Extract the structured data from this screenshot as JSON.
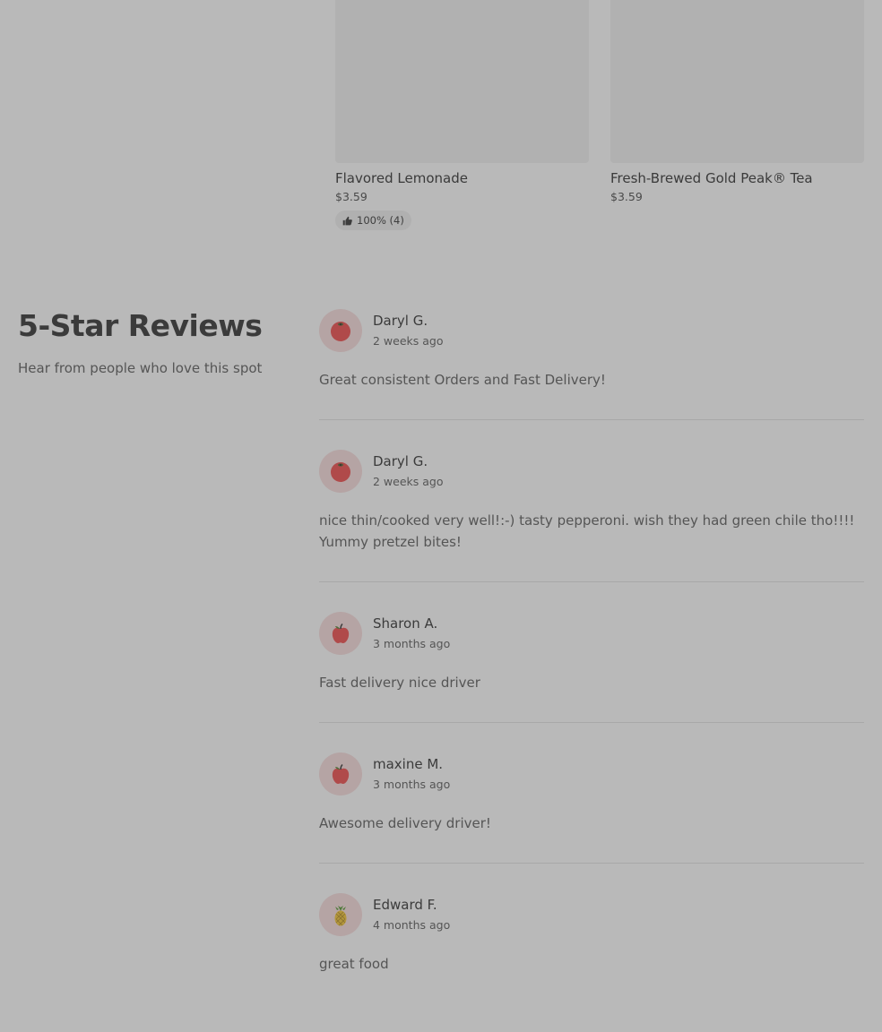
{
  "products": [
    {
      "name": "Flavored Lemonade",
      "price": "$3.59",
      "rating": "100% (4)",
      "has_rating": true
    },
    {
      "name": "Fresh-Brewed Gold Peak® Tea",
      "price": "$3.59",
      "rating": "",
      "has_rating": false
    }
  ],
  "reviews_section": {
    "title": "5-Star Reviews",
    "subtitle": "Hear from people who love this spot"
  },
  "reviews": [
    {
      "author": "Daryl G.",
      "when": "2 weeks ago",
      "avatar": "tomato-icon",
      "text": "Great consistent Orders and Fast Delivery!"
    },
    {
      "author": "Daryl G.",
      "when": "2 weeks ago",
      "avatar": "tomato-icon",
      "text": "nice thin/cooked very well!:-) tasty pepperoni. wish they had green chile tho!!!! Yummy pretzel bites!"
    },
    {
      "author": "Sharon A.",
      "when": "3 months ago",
      "avatar": "apple-icon",
      "text": "Fast delivery nice driver"
    },
    {
      "author": "maxine M.",
      "when": "3 months ago",
      "avatar": "apple-icon",
      "text": "Awesome delivery driver!"
    },
    {
      "author": "Edward F.",
      "when": "4 months ago",
      "avatar": "pineapple-icon",
      "text": "great food"
    }
  ],
  "colors": {
    "overlay_bg": "#b9b9b9",
    "avatar_bg": "#b5a4a4",
    "fruit_red": "#b04a4a"
  }
}
